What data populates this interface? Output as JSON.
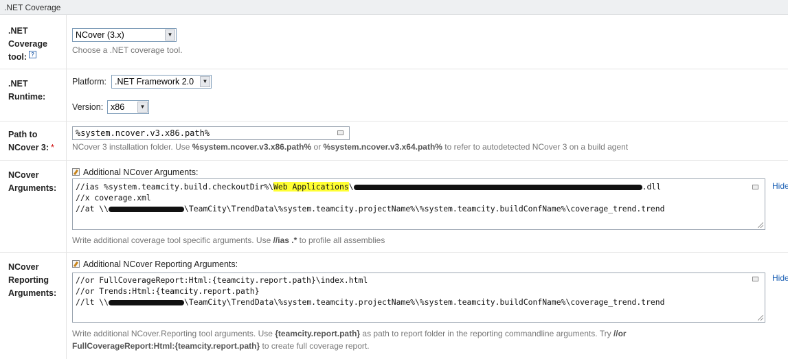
{
  "section": {
    "title": ".NET Coverage"
  },
  "coverage_tool": {
    "label_lines": [
      ".NET",
      "Coverage",
      "tool:"
    ],
    "help_glyph": "?",
    "selected": "NCover (3.x)",
    "hint": "Choose a .NET coverage tool."
  },
  "runtime": {
    "label_lines": [
      ".NET",
      "Runtime:"
    ],
    "platform_label": "Platform:",
    "platform_value": ".NET Framework 2.0",
    "version_label": "Version:",
    "version_value": "x86"
  },
  "ncover_path": {
    "label_lines": [
      "Path to",
      "NCover 3:"
    ],
    "required_mark": "*",
    "value": "%system.ncover.v3.x86.path%",
    "hint_pre": "NCover 3 installation folder. Use ",
    "hint_b1": "%system.ncover.v3.x86.path%",
    "hint_mid": " or ",
    "hint_b2": "%system.ncover.v3.x64.path%",
    "hint_post": " to refer to autodetected NCover 3 on a build agent"
  },
  "ncover_args": {
    "label_lines": [
      "NCover",
      "Arguments:"
    ],
    "title": "Additional NCover Arguments:",
    "line1_pre": "//ias %system.teamcity.build.checkoutDir%\\",
    "line1_hl": "Web Applications",
    "line1_post": "\\",
    "line1_tail": ".dll",
    "line2": "//x coverage.xml",
    "line3_pre": "//at \\\\",
    "line3_post": "\\TeamCity\\TrendData\\%system.teamcity.projectName%\\%system.teamcity.buildConfName%\\coverage_trend.trend",
    "hide_label": "Hide",
    "hint_pre": "Write additional coverage tool specific arguments. Use ",
    "hint_b": "//ias .*",
    "hint_post": " to profile all assemblies"
  },
  "reporting_args": {
    "label_lines": [
      "NCover",
      "Reporting",
      "Arguments:"
    ],
    "title": "Additional NCover Reporting Arguments:",
    "line1": "//or FullCoverageReport:Html:{teamcity.report.path}\\index.html",
    "line2": "//or Trends:Html:{teamcity.report.path}",
    "line3_pre": "//lt \\\\",
    "line3_post": "\\TeamCity\\TrendData\\%system.teamcity.projectName%\\%system.teamcity.buildConfName%\\coverage_trend.trend",
    "hide_label": "Hide",
    "hint1_pre": "Write additional NCover.Reporting tool arguments. Use ",
    "hint1_b": "{teamcity.report.path}",
    "hint1_mid": " as path to report folder in the reporting commandline arguments. Try ",
    "hint1_b2": "//or",
    "hint2_b": "FullCoverageReport:Html:{teamcity.report.path}",
    "hint2_post": " to create full coverage report."
  }
}
